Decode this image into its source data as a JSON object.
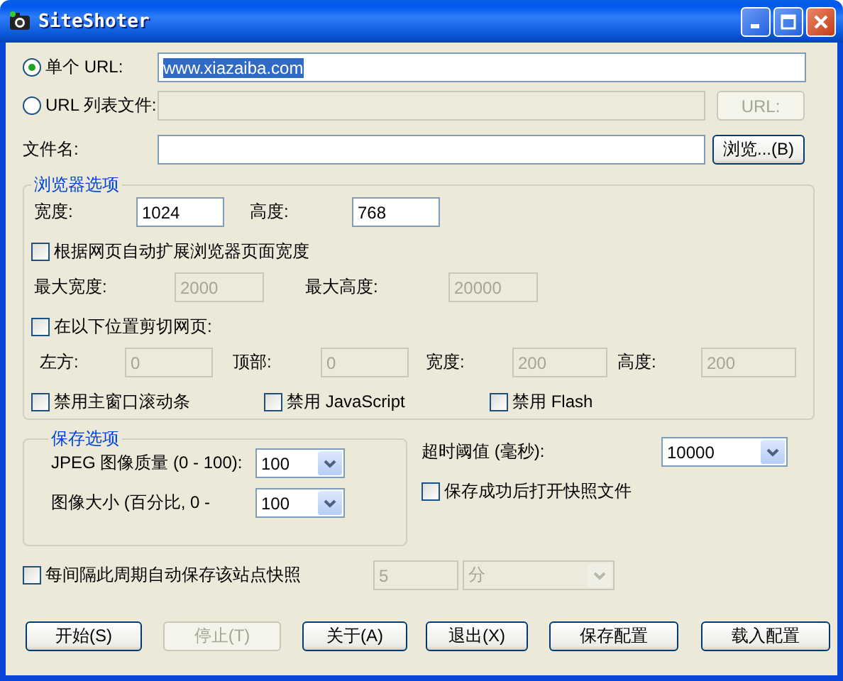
{
  "window": {
    "title": "SiteShoter"
  },
  "source": {
    "options": [
      {
        "label": "单个 URL:",
        "selected": true,
        "value": "www.xiazaiba.com",
        "value_highlighted": true,
        "disabled": false
      },
      {
        "label": "URL 列表文件:",
        "selected": false,
        "disabled": true,
        "button": {
          "label": "URL:",
          "disabled": true
        }
      }
    ]
  },
  "file": {
    "label": "文件名:",
    "browse_button": "浏览...(B)"
  },
  "browser_options": {
    "title": "浏览器选项",
    "size_fields": [
      {
        "label": "宽度:",
        "value": "1024",
        "disabled": false
      },
      {
        "label": "高度:",
        "value": "768",
        "disabled": false
      }
    ],
    "auto_expand": {
      "label": "根据网页自动扩展浏览器页面宽度",
      "checked": false
    },
    "max_fields": [
      {
        "label": "最大宽度:",
        "value": "2000",
        "disabled": true
      },
      {
        "label": "最大高度:",
        "value": "20000",
        "disabled": true
      }
    ],
    "crop": {
      "label": "在以下位置剪切网页:",
      "checked": false
    },
    "crop_fields": [
      {
        "label": "左方:",
        "value": "0",
        "disabled": true
      },
      {
        "label": "顶部:",
        "value": "0",
        "disabled": true
      },
      {
        "label": "宽度:",
        "value": "200",
        "disabled": true
      },
      {
        "label": "高度:",
        "value": "200",
        "disabled": true
      }
    ],
    "disable_checks": [
      {
        "label": "禁用主窗口滚动条",
        "checked": false
      },
      {
        "label": "禁用 JavaScript",
        "checked": false
      },
      {
        "label": "禁用 Flash",
        "checked": false
      }
    ]
  },
  "save_options": {
    "title": "保存选项",
    "fields": [
      {
        "label": "JPEG 图像质量 (0 - 100):",
        "value": "100"
      },
      {
        "label": "图像大小 (百分比, 0 -",
        "value": "100"
      }
    ]
  },
  "timeout": {
    "label": "超时阈值 (毫秒):",
    "value": "10000"
  },
  "open_after_save": {
    "label": "保存成功后打开快照文件",
    "checked": false
  },
  "periodic": {
    "label": "每间隔此周期自动保存该站点快照",
    "checked": false,
    "interval": {
      "value": "5",
      "disabled": true
    },
    "unit": {
      "value": "分",
      "disabled": true
    }
  },
  "buttons": [
    {
      "label": "开始(S)",
      "disabled": false
    },
    {
      "label": "停止(T)",
      "disabled": true
    },
    {
      "label": "关于(A)",
      "disabled": false
    },
    {
      "label": "退出(X)",
      "disabled": false
    },
    {
      "label": "保存配置",
      "disabled": false
    },
    {
      "label": "载入配置",
      "disabled": false
    }
  ]
}
